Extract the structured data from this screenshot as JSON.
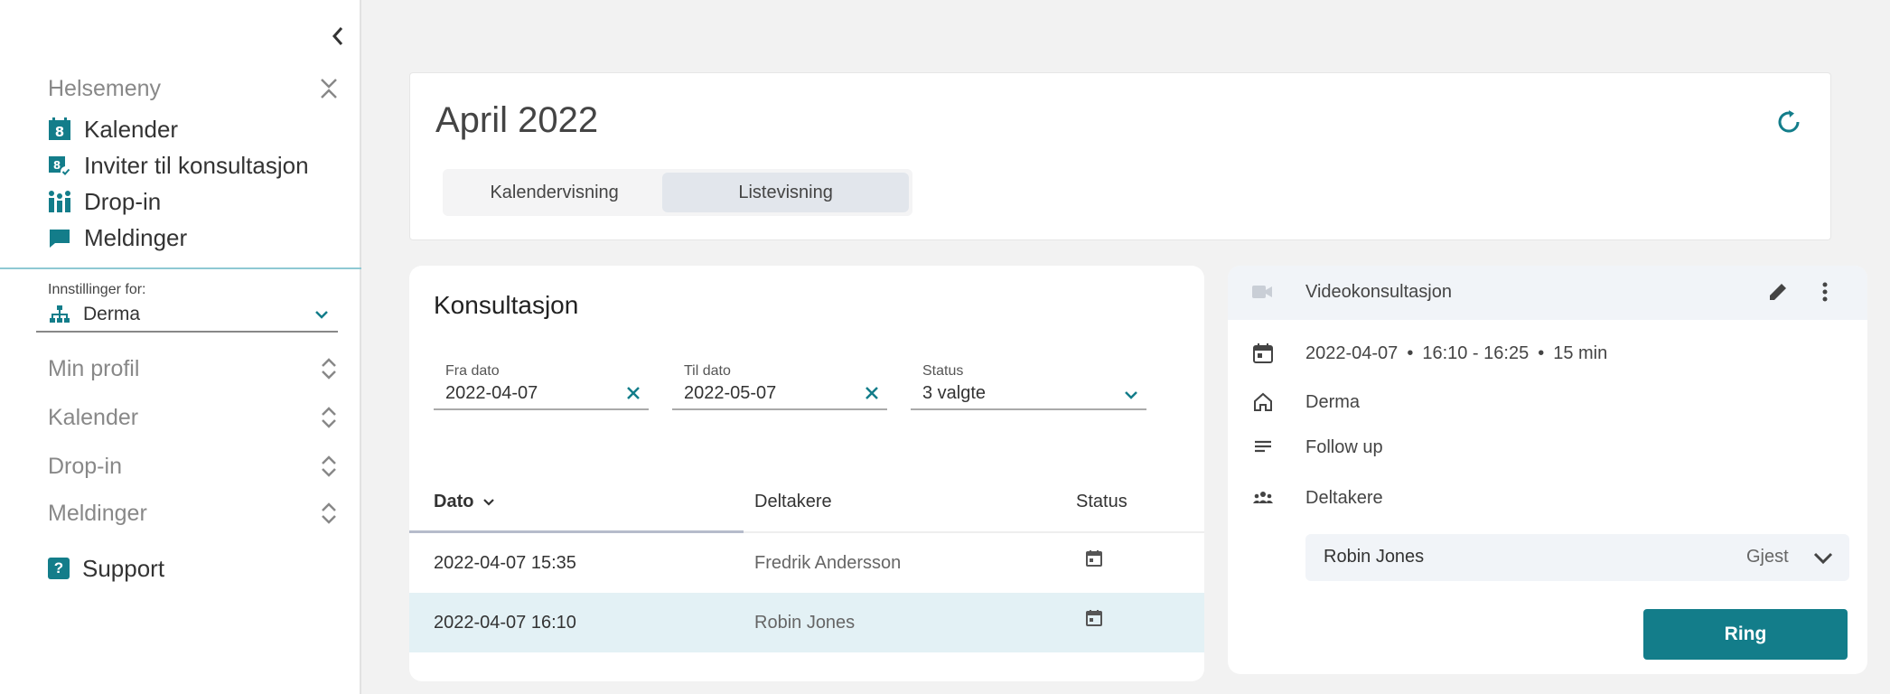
{
  "sidebar": {
    "menu_title": "Helsemeny",
    "items": [
      {
        "label": "Kalender",
        "icon": "calendar-icon"
      },
      {
        "label": "Inviter til konsultasjon",
        "icon": "calendar-check-icon"
      },
      {
        "label": "Drop-in",
        "icon": "queue-icon"
      },
      {
        "label": "Meldinger",
        "icon": "chat-icon"
      }
    ],
    "settings_label": "Innstillinger for:",
    "settings_value": "Derma",
    "accordion": [
      {
        "label": "Min profil"
      },
      {
        "label": "Kalender"
      },
      {
        "label": "Drop-in"
      },
      {
        "label": "Meldinger"
      }
    ],
    "support_label": "Support"
  },
  "header": {
    "title": "April 2022",
    "tabs": [
      {
        "label": "Kalendervisning",
        "active": false
      },
      {
        "label": "Listevisning",
        "active": true
      }
    ]
  },
  "list": {
    "title": "Konsultasjon",
    "filters": {
      "from_label": "Fra dato",
      "from_value": "2022-04-07",
      "to_label": "Til dato",
      "to_value": "2022-05-07",
      "status_label": "Status",
      "status_value": "3 valgte"
    },
    "columns": [
      "Dato",
      "Deltakere",
      "Status"
    ],
    "rows": [
      {
        "date": "2022-04-07 15:35",
        "participant": "Fredrik Andersson",
        "status_icon": "calendar-icon",
        "selected": false
      },
      {
        "date": "2022-04-07 16:10",
        "participant": "Robin Jones",
        "status_icon": "calendar-icon",
        "selected": true
      }
    ]
  },
  "detail": {
    "title": "Videokonsultasjon",
    "date": "2022-04-07",
    "time": "16:10 - 16:25",
    "duration": "15 min",
    "location": "Derma",
    "note": "Follow up",
    "participants_label": "Deltakere",
    "participant": {
      "name": "Robin Jones",
      "role": "Gjest"
    },
    "call_label": "Ring"
  },
  "colors": {
    "accent": "#137d8a",
    "selected_row": "#e3f1f5",
    "divider": "#8fc9d3"
  }
}
